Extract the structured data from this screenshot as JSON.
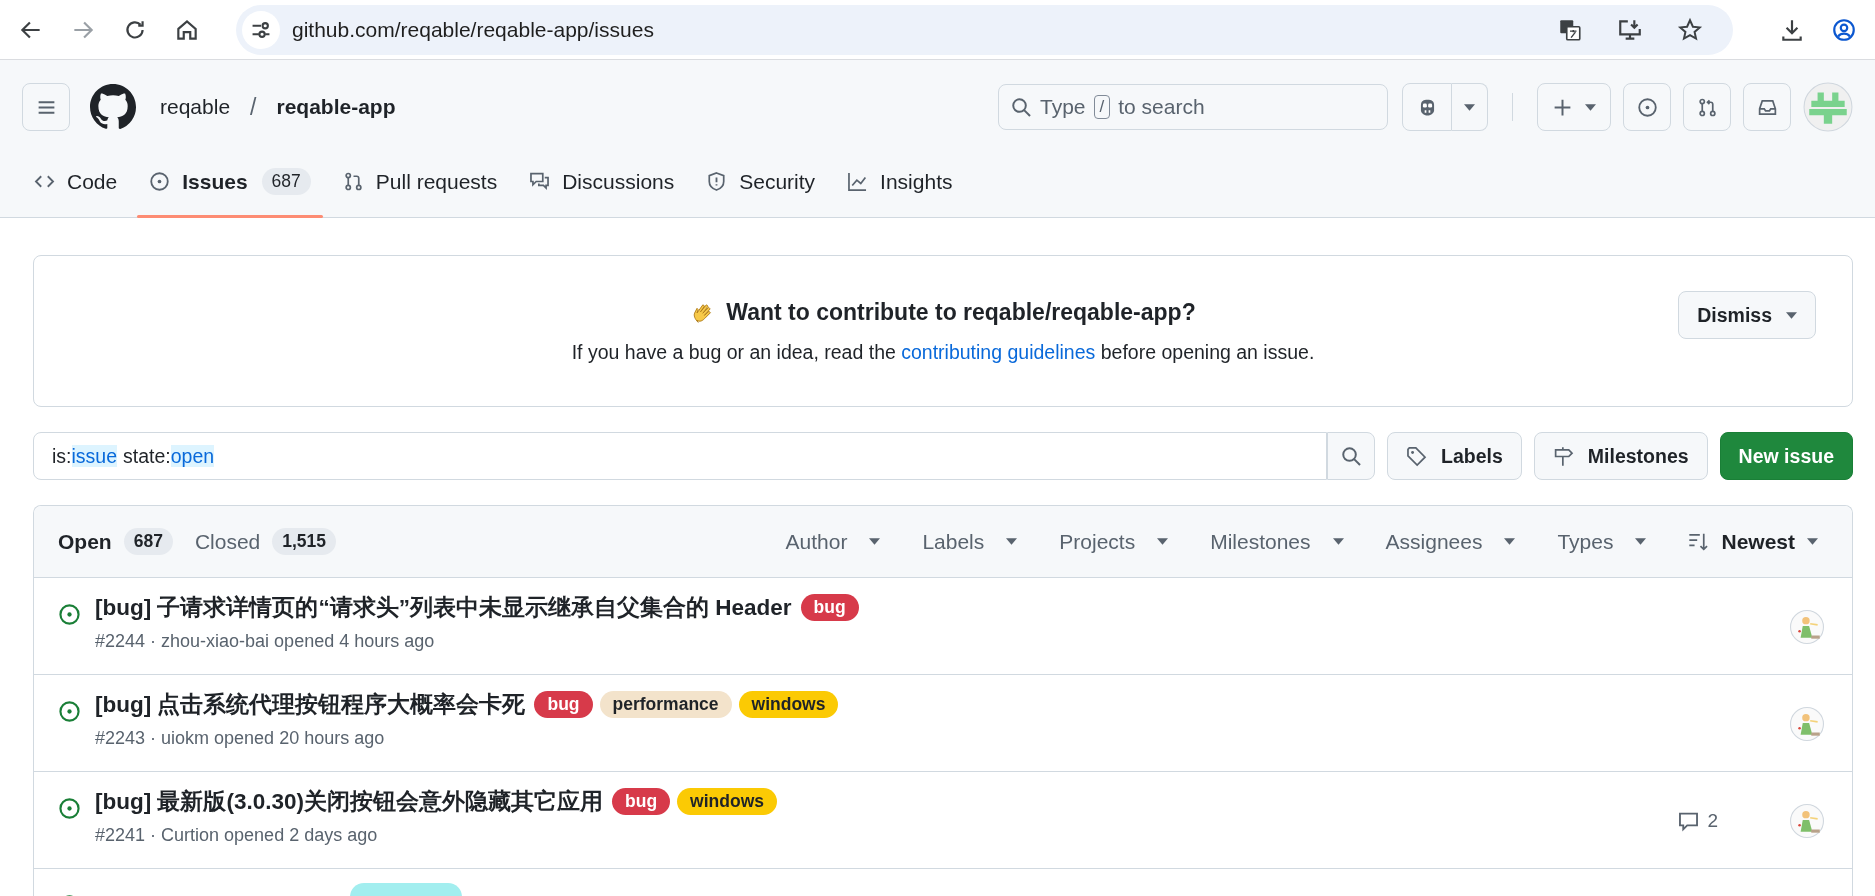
{
  "browser": {
    "url": "github.com/reqable/reqable-app/issues",
    "forward_disabled": true
  },
  "header": {
    "owner": "reqable",
    "separator": "/",
    "repo": "reqable-app",
    "search": {
      "before": "Type",
      "key": "/",
      "after": "to search"
    }
  },
  "tabs": [
    {
      "label": "Code",
      "selected": false
    },
    {
      "label": "Issues",
      "count": "687",
      "selected": true
    },
    {
      "label": "Pull requests",
      "selected": false
    },
    {
      "label": "Discussions",
      "selected": false
    },
    {
      "label": "Security",
      "selected": false
    },
    {
      "label": "Insights",
      "selected": false
    }
  ],
  "banner": {
    "title": "Want to contribute to reqable/reqable-app?",
    "text_before": "If you have a bug or an idea, read the",
    "link": "contributing guidelines",
    "text_after": "before opening an issue.",
    "dismiss": "Dismiss"
  },
  "query": [
    {
      "text": "is:",
      "kind": "key"
    },
    {
      "text": "issue",
      "kind": "value"
    },
    {
      "text": "state:",
      "kind": "key"
    },
    {
      "text": "open",
      "kind": "value"
    }
  ],
  "buttons": {
    "labels": "Labels",
    "milestones": "Milestones",
    "new_issue": "New issue"
  },
  "states": [
    {
      "label": "Open",
      "count": "687",
      "selected": true
    },
    {
      "label": "Closed",
      "count": "1,515",
      "selected": false
    }
  ],
  "filters": [
    "Author",
    "Labels",
    "Projects",
    "Milestones",
    "Assignees",
    "Types"
  ],
  "sort": "Newest",
  "issues": [
    {
      "title": "[bug] 子请求详情页的“请求头”列表中未显示继承自父集合的 Header",
      "labels": [
        {
          "name": "bug",
          "color": "#d73a4a"
        }
      ],
      "meta": "#2244 · zhou-xiao-bai opened 4 hours ago"
    },
    {
      "title": "[bug] 点击系统代理按钮程序大概率会卡死",
      "labels": [
        {
          "name": "bug",
          "color": "#d73a4a"
        },
        {
          "name": "performance",
          "color": "#f3e3cb"
        },
        {
          "name": "windows",
          "color": "#fbca04"
        }
      ],
      "meta": "#2243 · uiokm opened 20 hours ago"
    },
    {
      "title": "[bug] 最新版(3.0.30)关闭按钮会意外隐藏其它应用",
      "labels": [
        {
          "name": "bug",
          "color": "#d73a4a"
        },
        {
          "name": "windows",
          "color": "#fbca04"
        }
      ],
      "meta": "#2241 · Curtion opened 2 days ago",
      "comments": "2"
    },
    {
      "labels": [
        {
          "color": "#a2eeef"
        }
      ]
    }
  ]
}
